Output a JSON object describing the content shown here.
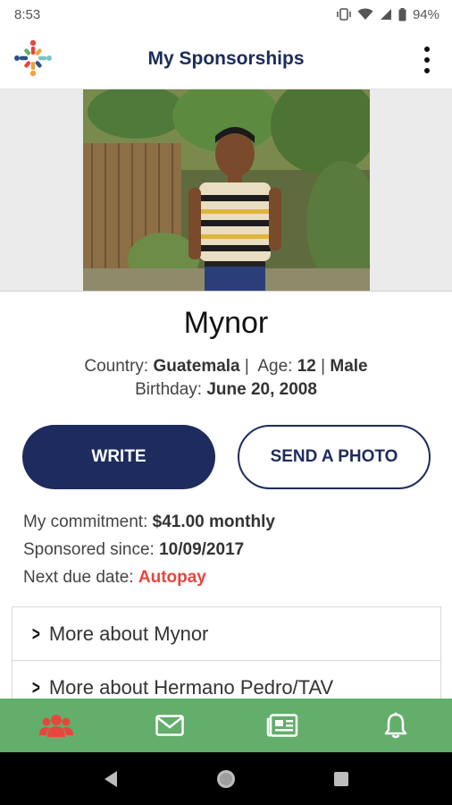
{
  "status_bar": {
    "time": "8:53",
    "battery": "94%",
    "icons": [
      "vibrate-icon",
      "wifi-icon",
      "signal-icon",
      "battery-icon"
    ]
  },
  "app_bar": {
    "title": "My Sponsorships",
    "menu_icon": "overflow-menu-icon",
    "logo_icon": "app-logo-icon"
  },
  "child": {
    "name": "Mynor",
    "country_label": "Country:",
    "country": "Guatemala",
    "age_label": "Age:",
    "age": "12",
    "gender": "Male",
    "birthday_label": "Birthday:",
    "birthday": "June 20, 2008"
  },
  "actions": {
    "write_label": "WRITE",
    "send_photo_label": "SEND A PHOTO"
  },
  "sponsorship": {
    "commitment_label": "My commitment:",
    "commitment": "$41.00 monthly",
    "since_label": "Sponsored since:",
    "since": "10/09/2017",
    "due_label": "Next due date:",
    "due": "Autopay"
  },
  "more": {
    "items": [
      {
        "label": "More about Mynor"
      },
      {
        "label": "More about Hermano Pedro/TAV"
      }
    ]
  },
  "bottom_nav": {
    "items": [
      "sponsorships-icon",
      "mail-icon",
      "news-icon",
      "notifications-icon"
    ],
    "active_color": "#e8463d",
    "background": "#63ae6b"
  },
  "colors": {
    "primary": "#1e2b5e",
    "accent": "#e8463d"
  }
}
